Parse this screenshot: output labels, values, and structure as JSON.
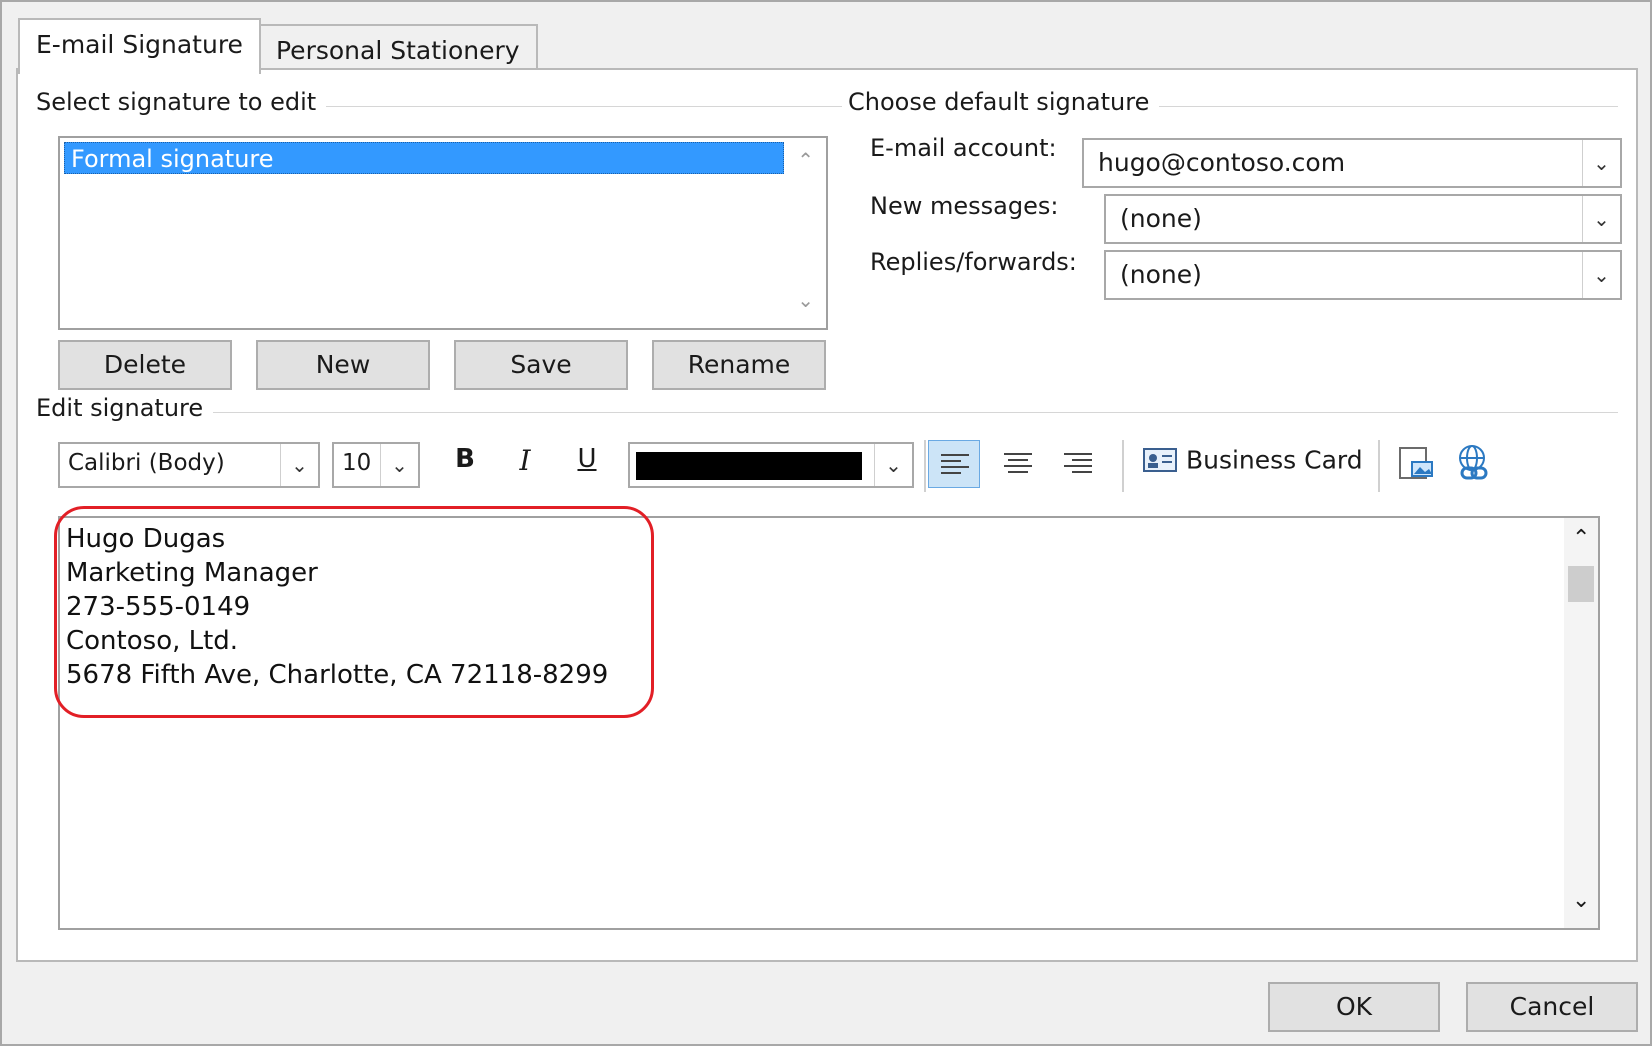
{
  "tabs": [
    {
      "label": "E-mail Signature",
      "active": true
    },
    {
      "label": "Personal Stationery",
      "active": false
    }
  ],
  "select_section": {
    "label": "Select signature to edit",
    "items": [
      "Formal signature"
    ],
    "selected": "Formal signature"
  },
  "sig_buttons": {
    "delete": "Delete",
    "new": "New",
    "save": "Save",
    "rename": "Rename"
  },
  "default_section": {
    "label": "Choose default signature",
    "email_account_label": "E-mail account:",
    "email_account_value": "hugo@contoso.com",
    "new_messages_label": "New messages:",
    "new_messages_value": "(none)",
    "replies_label": "Replies/forwards:",
    "replies_value": "(none)"
  },
  "edit_section": {
    "label": "Edit signature",
    "font": "Calibri (Body)",
    "size": "10",
    "bold": "B",
    "italic": "I",
    "underline": "U",
    "text_color": "#000000",
    "business_card": "Business Card"
  },
  "signature_lines": [
    "Hugo Dugas",
    "Marketing Manager",
    "273-555-0149",
    "Contoso, Ltd.",
    "5678 Fifth Ave, Charlotte, CA 72118-8299"
  ],
  "footer": {
    "ok": "OK",
    "cancel": "Cancel"
  },
  "colors": {
    "selection": "#3399ff",
    "highlight_ring": "#e21f26",
    "align_active": "#cce4f7"
  }
}
